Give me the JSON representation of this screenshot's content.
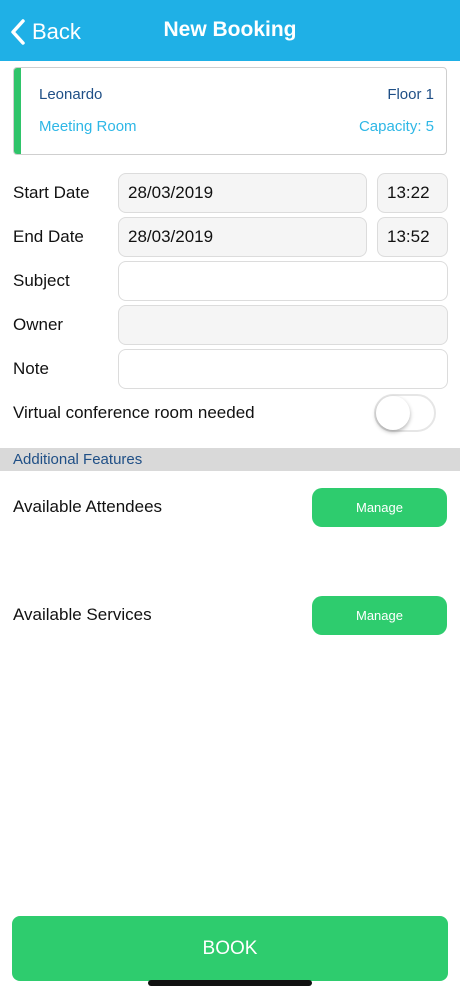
{
  "navbar": {
    "back_label": "Back",
    "title": "New Booking",
    "back_icon": "chevron-left-icon"
  },
  "room": {
    "name": "Leonardo",
    "floor": "Floor 1",
    "type": "Meeting Room",
    "capacity": "Capacity: 5"
  },
  "form": {
    "start_label": "Start Date",
    "start_date": "28/03/2019",
    "start_time": "13:22",
    "end_label": "End Date",
    "end_date": "28/03/2019",
    "end_time": "13:52",
    "subject_label": "Subject",
    "subject_value": "",
    "owner_label": "Owner",
    "owner_value": "",
    "note_label": "Note",
    "note_value": "",
    "virtual_label": "Virtual conference room needed",
    "virtual_enabled": false
  },
  "additional": {
    "header": "Additional Features",
    "attendees_label": "Available Attendees",
    "attendees_button": "Manage",
    "services_label": "Available Services",
    "services_button": "Manage"
  },
  "book_button": "BOOK",
  "colors": {
    "navbar": "#1fb0e6",
    "accent_green": "#2ecc6e",
    "navy_text": "#1f4f86",
    "light_blue_text": "#2eb7e6"
  }
}
